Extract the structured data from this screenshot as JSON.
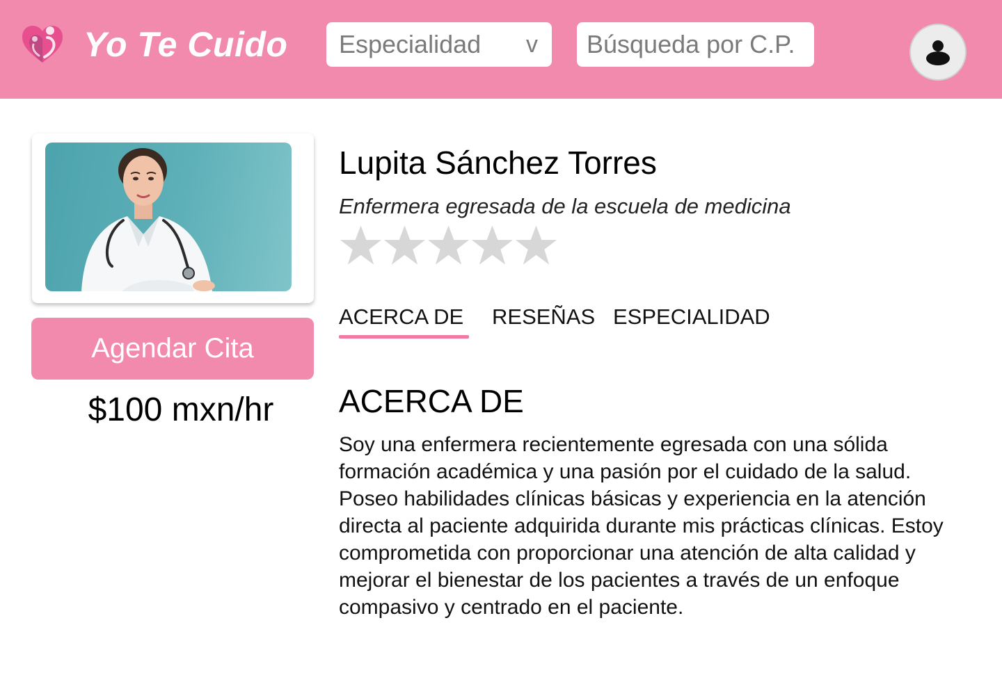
{
  "header": {
    "brand": "Yo Te Cuido",
    "specialty_select": {
      "value": "Especialidad",
      "caret": "v"
    },
    "postal_search": {
      "placeholder": "Búsqueda por C.P."
    },
    "avatar_icon": "user-avatar-icon",
    "background_color": "#f28aae",
    "logo_icon": "family-heart-logo-icon"
  },
  "profile": {
    "photo_icon": "nurse-portrait-photo",
    "book_button_label": "Agendar Cita",
    "price": "$100 mxn/hr",
    "name": "Lupita Sánchez Torres",
    "subtitle": "Enfermera egresada de la escuela de medicina",
    "rating": {
      "value": 0,
      "max": 5,
      "empty_color": "#d7d7d7"
    }
  },
  "tabs": [
    {
      "label": "ACERCA DE",
      "active": true
    },
    {
      "label": "RESEÑAS",
      "active": false
    },
    {
      "label": "ESPECIALIDAD",
      "active": false
    }
  ],
  "about": {
    "title": "ACERCA DE",
    "text": "Soy una enfermera recientemente egresada con una sólida formación académica y una pasión por el cuidado de la salud. Poseo habilidades clínicas básicas y experiencia en la atención directa al paciente adquirida durante mis prácticas clínicas. Estoy comprometida con proporcionar una atención de alta calidad y mejorar el bienestar de los pacientes a través de un enfoque compasivo y centrado en el paciente."
  },
  "colors": {
    "accent": "#f28aae",
    "tab_underline": "#f07aa4"
  }
}
